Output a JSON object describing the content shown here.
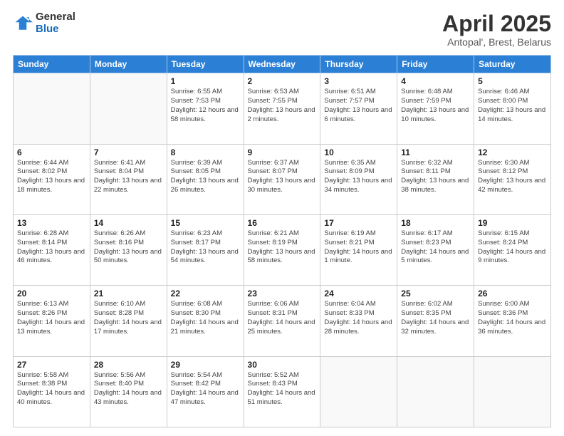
{
  "logo": {
    "general": "General",
    "blue": "Blue"
  },
  "header": {
    "title": "April 2025",
    "subtitle": "Antopal', Brest, Belarus"
  },
  "weekdays": [
    "Sunday",
    "Monday",
    "Tuesday",
    "Wednesday",
    "Thursday",
    "Friday",
    "Saturday"
  ],
  "weeks": [
    [
      {
        "day": "",
        "info": ""
      },
      {
        "day": "",
        "info": ""
      },
      {
        "day": "1",
        "info": "Sunrise: 6:55 AM\nSunset: 7:53 PM\nDaylight: 12 hours and 58 minutes."
      },
      {
        "day": "2",
        "info": "Sunrise: 6:53 AM\nSunset: 7:55 PM\nDaylight: 13 hours and 2 minutes."
      },
      {
        "day": "3",
        "info": "Sunrise: 6:51 AM\nSunset: 7:57 PM\nDaylight: 13 hours and 6 minutes."
      },
      {
        "day": "4",
        "info": "Sunrise: 6:48 AM\nSunset: 7:59 PM\nDaylight: 13 hours and 10 minutes."
      },
      {
        "day": "5",
        "info": "Sunrise: 6:46 AM\nSunset: 8:00 PM\nDaylight: 13 hours and 14 minutes."
      }
    ],
    [
      {
        "day": "6",
        "info": "Sunrise: 6:44 AM\nSunset: 8:02 PM\nDaylight: 13 hours and 18 minutes."
      },
      {
        "day": "7",
        "info": "Sunrise: 6:41 AM\nSunset: 8:04 PM\nDaylight: 13 hours and 22 minutes."
      },
      {
        "day": "8",
        "info": "Sunrise: 6:39 AM\nSunset: 8:05 PM\nDaylight: 13 hours and 26 minutes."
      },
      {
        "day": "9",
        "info": "Sunrise: 6:37 AM\nSunset: 8:07 PM\nDaylight: 13 hours and 30 minutes."
      },
      {
        "day": "10",
        "info": "Sunrise: 6:35 AM\nSunset: 8:09 PM\nDaylight: 13 hours and 34 minutes."
      },
      {
        "day": "11",
        "info": "Sunrise: 6:32 AM\nSunset: 8:11 PM\nDaylight: 13 hours and 38 minutes."
      },
      {
        "day": "12",
        "info": "Sunrise: 6:30 AM\nSunset: 8:12 PM\nDaylight: 13 hours and 42 minutes."
      }
    ],
    [
      {
        "day": "13",
        "info": "Sunrise: 6:28 AM\nSunset: 8:14 PM\nDaylight: 13 hours and 46 minutes."
      },
      {
        "day": "14",
        "info": "Sunrise: 6:26 AM\nSunset: 8:16 PM\nDaylight: 13 hours and 50 minutes."
      },
      {
        "day": "15",
        "info": "Sunrise: 6:23 AM\nSunset: 8:17 PM\nDaylight: 13 hours and 54 minutes."
      },
      {
        "day": "16",
        "info": "Sunrise: 6:21 AM\nSunset: 8:19 PM\nDaylight: 13 hours and 58 minutes."
      },
      {
        "day": "17",
        "info": "Sunrise: 6:19 AM\nSunset: 8:21 PM\nDaylight: 14 hours and 1 minute."
      },
      {
        "day": "18",
        "info": "Sunrise: 6:17 AM\nSunset: 8:23 PM\nDaylight: 14 hours and 5 minutes."
      },
      {
        "day": "19",
        "info": "Sunrise: 6:15 AM\nSunset: 8:24 PM\nDaylight: 14 hours and 9 minutes."
      }
    ],
    [
      {
        "day": "20",
        "info": "Sunrise: 6:13 AM\nSunset: 8:26 PM\nDaylight: 14 hours and 13 minutes."
      },
      {
        "day": "21",
        "info": "Sunrise: 6:10 AM\nSunset: 8:28 PM\nDaylight: 14 hours and 17 minutes."
      },
      {
        "day": "22",
        "info": "Sunrise: 6:08 AM\nSunset: 8:30 PM\nDaylight: 14 hours and 21 minutes."
      },
      {
        "day": "23",
        "info": "Sunrise: 6:06 AM\nSunset: 8:31 PM\nDaylight: 14 hours and 25 minutes."
      },
      {
        "day": "24",
        "info": "Sunrise: 6:04 AM\nSunset: 8:33 PM\nDaylight: 14 hours and 28 minutes."
      },
      {
        "day": "25",
        "info": "Sunrise: 6:02 AM\nSunset: 8:35 PM\nDaylight: 14 hours and 32 minutes."
      },
      {
        "day": "26",
        "info": "Sunrise: 6:00 AM\nSunset: 8:36 PM\nDaylight: 14 hours and 36 minutes."
      }
    ],
    [
      {
        "day": "27",
        "info": "Sunrise: 5:58 AM\nSunset: 8:38 PM\nDaylight: 14 hours and 40 minutes."
      },
      {
        "day": "28",
        "info": "Sunrise: 5:56 AM\nSunset: 8:40 PM\nDaylight: 14 hours and 43 minutes."
      },
      {
        "day": "29",
        "info": "Sunrise: 5:54 AM\nSunset: 8:42 PM\nDaylight: 14 hours and 47 minutes."
      },
      {
        "day": "30",
        "info": "Sunrise: 5:52 AM\nSunset: 8:43 PM\nDaylight: 14 hours and 51 minutes."
      },
      {
        "day": "",
        "info": ""
      },
      {
        "day": "",
        "info": ""
      },
      {
        "day": "",
        "info": ""
      }
    ]
  ]
}
